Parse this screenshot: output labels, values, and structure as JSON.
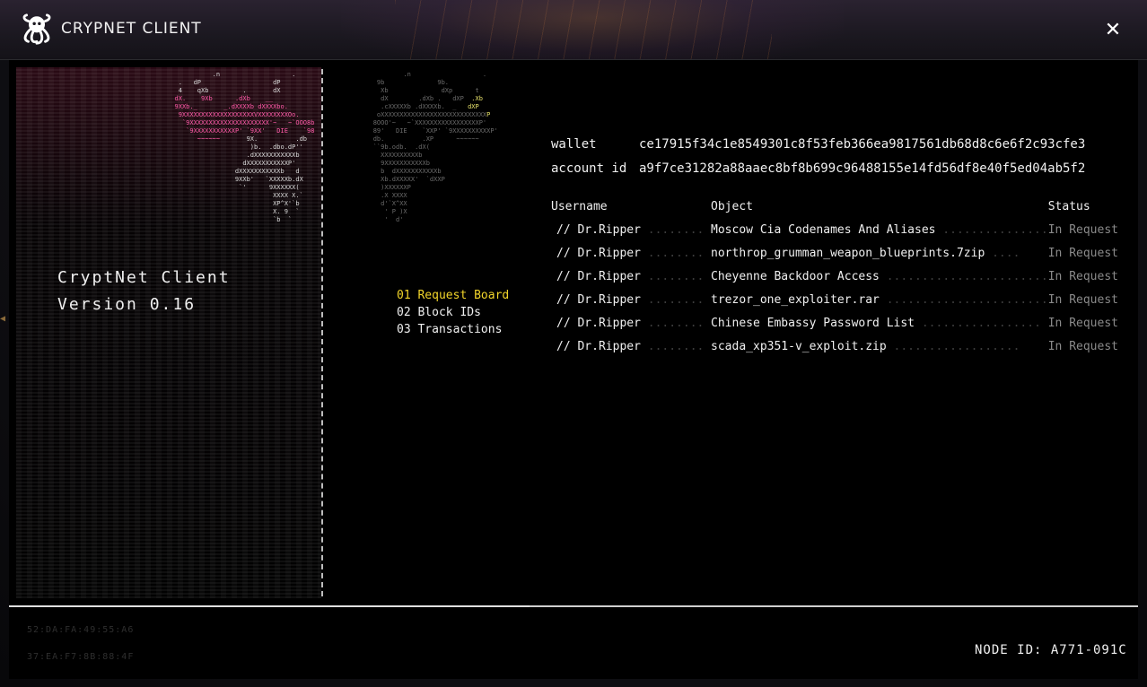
{
  "window": {
    "title": "CRYPNET CLIENT",
    "close_label": "✕"
  },
  "client": {
    "name": "CryptNet Client",
    "version": "Version 0.16"
  },
  "menu": {
    "items": [
      {
        "label": "01 Request Board",
        "active": true
      },
      {
        "label": "02 Block IDs",
        "active": false
      },
      {
        "label": "03 Transactions",
        "active": false
      }
    ]
  },
  "wallet": {
    "wallet_label": "wallet",
    "wallet_value": "ce17915f34c1e8549301c8f53feb366ea9817561db68d8c6e6f2c93cfe3",
    "account_label": "account id",
    "account_value": "a9f7ce31282a88aaec8bf8b699c96488155e14fd56df8e40f5ed04ab5f2"
  },
  "request_table": {
    "headers": [
      "Username",
      "Object",
      "Status"
    ],
    "rows": [
      {
        "user": "// Dr.Ripper",
        "object": "Moscow Cia Codenames And Aliases",
        "status": "In Request"
      },
      {
        "user": "// Dr.Ripper",
        "object": "northrop_grumman_weapon_blueprints.7zip",
        "status": "In Request"
      },
      {
        "user": "// Dr.Ripper",
        "object": "Cheyenne Backdoor Access",
        "status": "In Request"
      },
      {
        "user": "// Dr.Ripper",
        "object": "trezor_one_exploiter.rar",
        "status": "In Request"
      },
      {
        "user": "// Dr.Ripper",
        "object": "Chinese Embassy Password List",
        "status": "In Request"
      },
      {
        "user": "// Dr.Ripper",
        "object": "scada_xp351-v_exploit.zip",
        "status": "In Request"
      }
    ]
  },
  "footer": {
    "mac_1": "52:DA:FA:49:55:A6",
    "mac_2": "37:EA:F7:8B:88:4F",
    "node_id": "NODE ID: A771-091C"
  },
  "colors": {
    "accent_active": "#f2d52a",
    "status_muted": "#8a8a8a",
    "ascii_pink": "#ff5aa8"
  }
}
